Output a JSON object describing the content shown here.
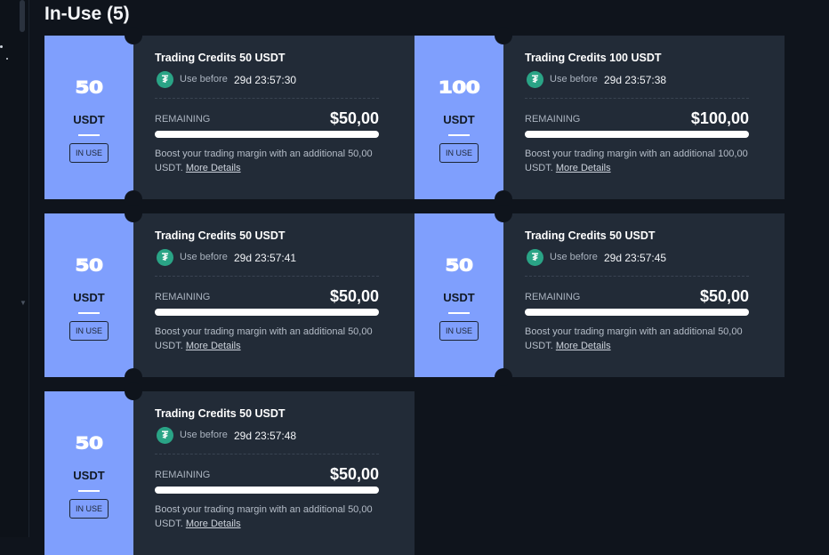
{
  "page": {
    "section_title": "In-Use (5)"
  },
  "colors": {
    "background": "#0f141c",
    "card_background": "#222b37",
    "stub_accent": "#7f9ffd",
    "tether_green": "#2aa486"
  },
  "icons": {
    "currency_icon": "tether-icon"
  },
  "cards": [
    {
      "amount": "50",
      "currency": "USDT",
      "status": "IN USE",
      "title": "Trading Credits 50 USDT",
      "use_before_label": "Use before",
      "expiry": "29d 23:57:30",
      "remaining_label": "REMAINING",
      "remaining_value": "$50,00",
      "remaining_fraction": 1.0,
      "description": "Boost your trading margin with an additional 50,00 USDT.",
      "more_details": "More Details"
    },
    {
      "amount": "100",
      "currency": "USDT",
      "status": "IN USE",
      "title": "Trading Credits 100 USDT",
      "use_before_label": "Use before",
      "expiry": "29d 23:57:38",
      "remaining_label": "REMAINING",
      "remaining_value": "$100,00",
      "remaining_fraction": 1.0,
      "description": "Boost your trading margin with an additional 100,00 USDT.",
      "more_details": "More Details"
    },
    {
      "amount": "50",
      "currency": "USDT",
      "status": "IN USE",
      "title": "Trading Credits 50 USDT",
      "use_before_label": "Use before",
      "expiry": "29d 23:57:41",
      "remaining_label": "REMAINING",
      "remaining_value": "$50,00",
      "remaining_fraction": 1.0,
      "description": "Boost your trading margin with an additional 50,00 USDT.",
      "more_details": "More Details"
    },
    {
      "amount": "50",
      "currency": "USDT",
      "status": "IN USE",
      "title": "Trading Credits 50 USDT",
      "use_before_label": "Use before",
      "expiry": "29d 23:57:45",
      "remaining_label": "REMAINING",
      "remaining_value": "$50,00",
      "remaining_fraction": 1.0,
      "description": "Boost your trading margin with an additional 50,00 USDT.",
      "more_details": "More Details"
    },
    {
      "amount": "50",
      "currency": "USDT",
      "status": "IN USE",
      "title": "Trading Credits 50 USDT",
      "use_before_label": "Use before",
      "expiry": "29d 23:57:48",
      "remaining_label": "REMAINING",
      "remaining_value": "$50,00",
      "remaining_fraction": 1.0,
      "description": "Boost your trading margin with an additional 50,00 USDT.",
      "more_details": "More Details"
    }
  ]
}
